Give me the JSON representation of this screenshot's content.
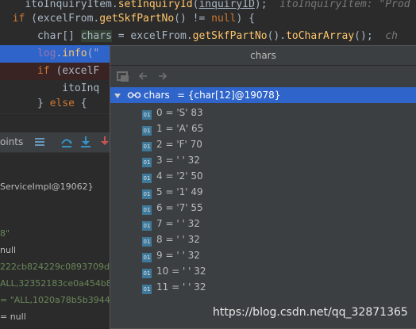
{
  "editor": {
    "line1": {
      "receiver": "itoInquiryItem",
      "method": "setInquiryId",
      "arg": "inquiryID",
      "hint": "itoInquiryItem: \"Prod"
    },
    "line2": {
      "kw_if": "if",
      "receiver": "excelFrom",
      "method": "getSkfPartNo",
      "rest": " != ",
      "kw_null": "null",
      "tail": ") {"
    },
    "line3": {
      "type": "char[]",
      "var": "chars",
      "expr_receiver": "excelFrom",
      "method1": "getSkfPartNo",
      "method2": "toCharArray",
      "hint": "ch"
    },
    "line4": {
      "field": "log",
      "method": "info",
      "partial": "(\""
    },
    "line5": {
      "kw_if": "if",
      "partial": " (excelF"
    },
    "line6": {
      "text": "itoInq"
    },
    "line7": {
      "kw_else": "else",
      "text": "} ",
      "brace": " {"
    }
  },
  "debug": {
    "toolbar_label": "oints",
    "frames": [
      "ServiceImpl@19062}",
      "",
      "8\"",
      "null",
      "222cb824229c0893709d",
      "ALL,32352183ce0a454b8",
      "= \"ALL,1020a78b5b3944",
      "= null"
    ]
  },
  "popup": {
    "title": "chars",
    "root": {
      "name": "chars",
      "value": "= {char[12]@19078}"
    },
    "badge": "01",
    "items": [
      {
        "index": "0",
        "value": "= 'S' 83"
      },
      {
        "index": "1",
        "value": "= 'A' 65"
      },
      {
        "index": "2",
        "value": "= 'F' 70"
      },
      {
        "index": "3",
        "value": "= ' ' 32"
      },
      {
        "index": "4",
        "value": "= '2' 50"
      },
      {
        "index": "5",
        "value": "= '1' 49"
      },
      {
        "index": "6",
        "value": "= '7' 55"
      },
      {
        "index": "7",
        "value": "= ' ' 32"
      },
      {
        "index": "8",
        "value": "= ' ' 32"
      },
      {
        "index": "9",
        "value": "= ' ' 32"
      },
      {
        "index": "10",
        "value": "= ' ' 32"
      },
      {
        "index": "11",
        "value": "= ' ' 32"
      }
    ]
  },
  "watermark": "https://blog.csdn.net/qq_32871365",
  "colors": {
    "selection": "#2f65ca",
    "panel": "#3c3f41",
    "editor_bg": "#2b2b2b",
    "badge": "#40789a"
  }
}
